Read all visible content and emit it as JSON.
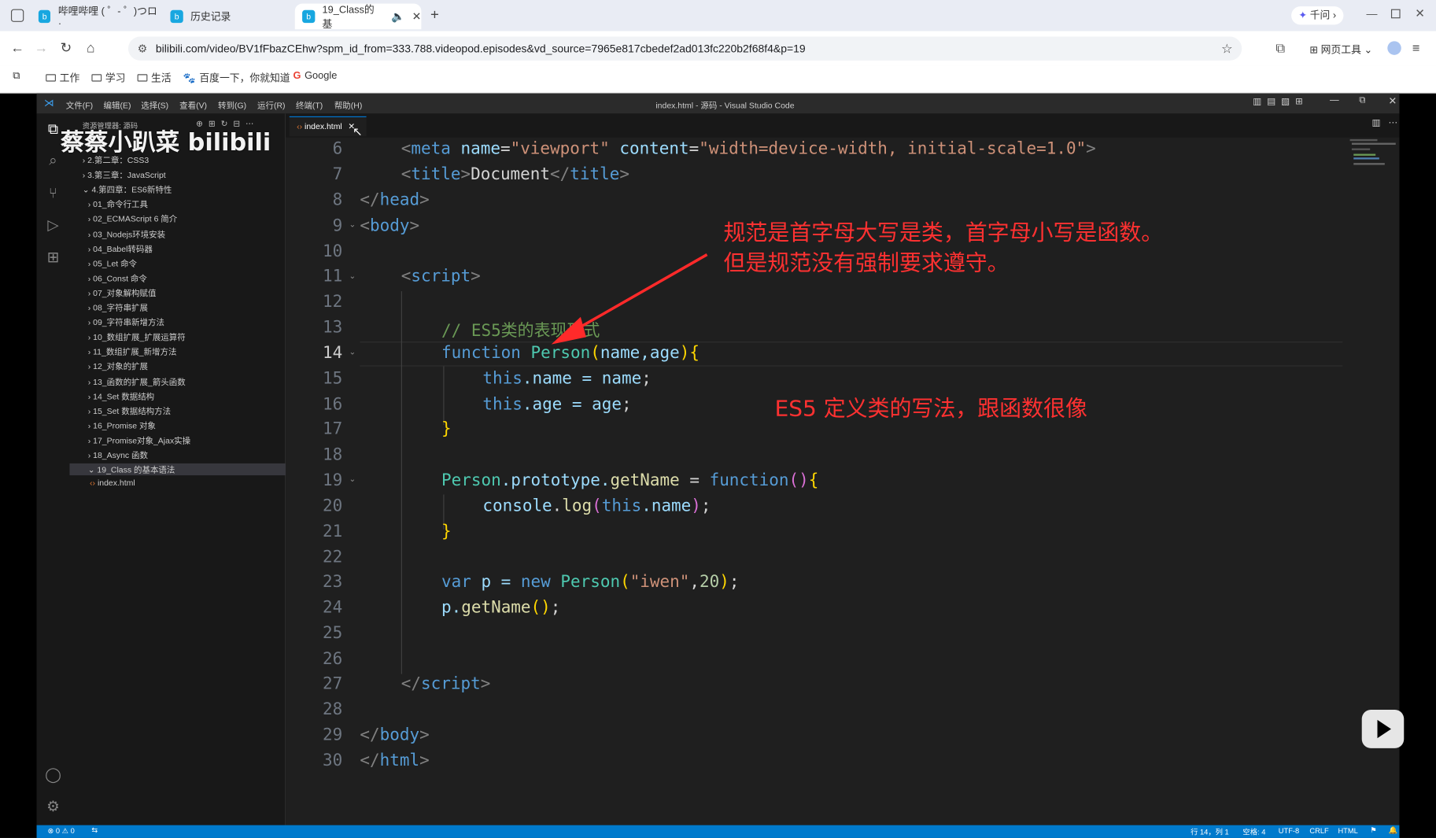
{
  "browser": {
    "tabs": [
      {
        "label": "哔哩哔哩 ( ゜- ゜)つロ ·"
      },
      {
        "label": "历史记录"
      },
      {
        "label": "19_Class的基"
      }
    ],
    "qianwen_label": "千问",
    "url": "bilibili.com/video/BV1fFbazCEhw?spm_id_from=333.788.videopod.episodes&vd_source=7965e817cbedef2ad013fc220b2f68f4&p=19",
    "web_tools_label": "网页工具",
    "bookmarks": [
      "工作",
      "学习",
      "生活",
      "百度一下，你就知道",
      "Google"
    ]
  },
  "vscode": {
    "window_title": "index.html - 源码 - Visual Studio Code",
    "menus": [
      "文件(F)",
      "编辑(E)",
      "选择(S)",
      "查看(V)",
      "转到(G)",
      "运行(R)",
      "终端(T)",
      "帮助(H)"
    ],
    "explorer_title": "资源管理器: 源码",
    "tree": [
      {
        "label": "2.第二章：CSS3",
        "level": 0
      },
      {
        "label": "3.第三章：JavaScript",
        "level": 0
      },
      {
        "label": "4.第四章：ES6新特性",
        "level": 0,
        "open": true
      },
      {
        "label": "01_命令行工具",
        "level": 1
      },
      {
        "label": "02_ECMAScript 6 简介",
        "level": 1
      },
      {
        "label": "03_Nodejs环境安装",
        "level": 1
      },
      {
        "label": "04_Babel转码器",
        "level": 1
      },
      {
        "label": "05_Let 命令",
        "level": 1
      },
      {
        "label": "06_Const 命令",
        "level": 1
      },
      {
        "label": "07_对象解构赋值",
        "level": 1
      },
      {
        "label": "08_字符串扩展",
        "level": 1
      },
      {
        "label": "09_字符串新增方法",
        "level": 1
      },
      {
        "label": "10_数组扩展_扩展运算符",
        "level": 1
      },
      {
        "label": "11_数组扩展_新增方法",
        "level": 1
      },
      {
        "label": "12_对象的扩展",
        "level": 1
      },
      {
        "label": "13_函数的扩展_箭头函数",
        "level": 1
      },
      {
        "label": "14_Set 数据结构",
        "level": 1
      },
      {
        "label": "15_Set 数据结构方法",
        "level": 1
      },
      {
        "label": "16_Promise 对象",
        "level": 1
      },
      {
        "label": "17_Promise对象_Ajax实操",
        "level": 1
      },
      {
        "label": "18_Async 函数",
        "level": 1
      },
      {
        "label": "19_Class 的基本语法",
        "level": 1,
        "open": true,
        "selected": true
      },
      {
        "label": "index.html",
        "level": 2,
        "file": true
      }
    ],
    "editor_tab": "index.html",
    "current_line": "14",
    "line_numbers": [
      "6",
      "7",
      "8",
      "9",
      "10",
      "11",
      "12",
      "13",
      "14",
      "15",
      "16",
      "17",
      "18",
      "19",
      "20",
      "21",
      "22",
      "23",
      "24",
      "25",
      "26",
      "27",
      "28",
      "29",
      "30"
    ],
    "status": {
      "problems": "⊗ 0 ⚠ 0",
      "position": "行 14，列 1",
      "spaces": "空格: 4",
      "encoding": "UTF-8",
      "eol": "CRLF",
      "language": "HTML"
    }
  },
  "code": {
    "l6": {
      "lt": "<",
      "tag": "meta",
      "a1": "name",
      "eq1": "=",
      "v1": "\"viewport\"",
      "a2": "content",
      "eq2": "=",
      "v2": "\"width=device-width, initial-scale=1.0\"",
      "gt": ">"
    },
    "l7": {
      "lt": "<",
      "tag": "title",
      "gt": ">",
      "text": "Document",
      "lt2": "</",
      "tag2": "title",
      "gt2": ">"
    },
    "l8": {
      "lt": "</",
      "tag": "head",
      "gt": ">"
    },
    "l9": {
      "lt": "<",
      "tag": "body",
      "gt": ">"
    },
    "l11": {
      "lt": "<",
      "tag": "script",
      "gt": ">"
    },
    "l13": "// ES5类的表现形式",
    "l14": {
      "kw": "function",
      "name": "Person",
      "open": "(",
      "params": "name,age",
      "close": ")",
      "brace": "{"
    },
    "l15": {
      "this": "this",
      "rest": ".name = ",
      "var": "name",
      "end": ";"
    },
    "l16": {
      "this": "this",
      "rest": ".age = ",
      "var": "age",
      "end": ";"
    },
    "l17": "}",
    "l19": {
      "cls": "Person",
      "rest": ".prototype.",
      "fn": "getName",
      "eq": " = ",
      "kw": "function",
      "paren": "()",
      "brace": "{"
    },
    "l20": {
      "obj": "console",
      "dot": ".",
      "fn": "log",
      "open": "(",
      "this": "this",
      "rest": ".name",
      "close": ")",
      "end": ";"
    },
    "l21": "}",
    "l23": {
      "kw": "var",
      "v": " p = ",
      "kw2": "new",
      "cls": "Person",
      "open": "(",
      "str": "\"iwen\"",
      "comma": ",",
      "num": "20",
      "close": ")",
      "end": ";"
    },
    "l24": {
      "v": "p.",
      "fn": "getName",
      "paren": "()",
      "end": ";"
    },
    "l27": {
      "lt": "</",
      "tag": "script",
      "gt": ">"
    },
    "l29": {
      "lt": "</",
      "tag": "body",
      "gt": ">"
    },
    "l30": {
      "lt": "</",
      "tag": "html",
      "gt": ">"
    }
  },
  "annotations": {
    "note1_line1": "规范是首字母大写是类，首字母小写是函数。",
    "note1_line2": "但是规范没有强制要求遵守。",
    "note2": "ES5 定义类的写法，跟函数很像"
  },
  "watermark": "蔡蔡小趴菜 bilibili",
  "colors": {
    "annotation": "#ff3131",
    "status_bar": "#007acc",
    "editor_bg": "#1f1f1f"
  }
}
